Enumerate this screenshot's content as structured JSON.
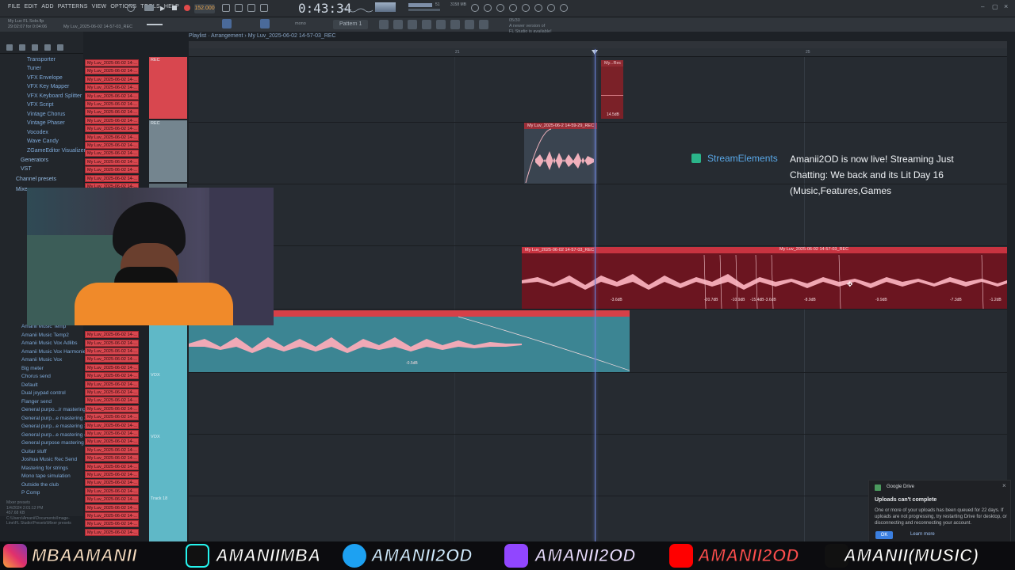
{
  "menu": [
    "FILE",
    "EDIT",
    "ADD",
    "PATTERNS",
    "VIEW",
    "OPTIONS",
    "TOOLS",
    "HELP"
  ],
  "transport": {
    "tempo": "152.000",
    "time": "0:43:34",
    "memory": "3158 MB",
    "cpu": "51"
  },
  "status": {
    "line1": "My Luv FL Solo.flp",
    "line2": "29:02:07 for 0:04:06",
    "line3": "My Luv_2025-06-02 14-57-03_REC"
  },
  "news": {
    "date": "05/30",
    "text1": "A newer version of",
    "text2": "FL Studio is available!"
  },
  "pattern_selector": "Pattern 1",
  "mono_label": "mono",
  "breadcrumb": "Playlist · Arrangement › My Luv_2025-06-02 14-57-03_REC",
  "browser": {
    "plugins": [
      "Transporter",
      "Tuner",
      "VFX Envelope",
      "VFX Key Mapper",
      "VFX Keyboard Splitter",
      "VFX Script",
      "Vintage Chorus",
      "Vintage Phaser",
      "Vocodex",
      "Wave Candy",
      "ZGameEditor Visualizer"
    ],
    "folders": [
      "Generators",
      "VST",
      "Channel presets",
      "Mixer"
    ],
    "presets": [
      "Amanii Music Temp",
      "Amanii Music Temp2",
      "Amanii Music Vox Adlibs",
      "Amanii Music Vox Harmonies",
      "Amanii Music Vox",
      "Big meter",
      "Chorus send",
      "Default",
      "Dual joypad control",
      "Flanger send",
      "General purpo...ir mastering",
      "General purp...e mastering 2",
      "General purp...e mastering 3",
      "General purp...e mastering 4",
      "General purpose mastering",
      "Guitar stuff",
      "Joshua Music Rec Send",
      "Mastering for strings",
      "Mono tape simulation",
      "Outside the club",
      "P Comp"
    ],
    "file_info": {
      "title": "Mixer presets",
      "date": "1/4/2024 2:01:12 PM",
      "size": "457.68 KB",
      "path": "C:\\Users\\Amanii\\Documents\\Image-Line\\FL Studio\\Presets\\Mixer presets"
    }
  },
  "clip_names": "My Luv_2025-06-02 14-...",
  "track_labels": {
    "rec1": "REC",
    "rec2": "REC",
    "vox1": "VOX",
    "vox2": "VOX",
    "track18": "Track 18"
  },
  "playlist_clips": {
    "clip_a_name": "My Luv_2025-06-2 14-59-29_REC",
    "clip_b_name": "My Luv_2025-06-02 14-57-03_REC",
    "clip_b_name2": "My Luv_2025-06-02 14-57-03_REC",
    "clip_c_name": "#3",
    "clip_d_name": "My...Rec",
    "clip_d_db": "14.5dB",
    "clip_c_db": "-0.5dB",
    "db_labels": [
      "-3.6dB",
      "-20.7dB",
      "-10.9dB",
      "-15.4dB",
      "-3.6dB",
      "-8.9dB",
      "-9.9dB",
      "-7.3dB",
      "-1.2dB"
    ]
  },
  "ruler_numbers": [
    "21",
    "25"
  ],
  "stream_alert": {
    "brand": "StreamElements",
    "message": "Amanii2OD is now live! Streaming Just Chatting: We back and its Lit Day 16 (Music,Features,Games"
  },
  "gdrive": {
    "title": "Google Drive",
    "heading": "Uploads can't complete",
    "body": "One or more of your uploads has been queued for 22 days. If uploads are not progressing, try restarting Drive for desktop, or disconnecting and reconnecting your account.",
    "ok": "OK",
    "learn": "Learn more"
  },
  "social": {
    "instagram": "MBAAMANII",
    "tiktok": "AMANIIMBA",
    "twitter": "AMANII2OD",
    "twitch": "AMANII2OD",
    "youtube": "AMANII2OD",
    "music": "AMANII(MUSIC)"
  },
  "colors": {
    "clip_red": "#d8474f",
    "clip_teal": "#5fb8c7",
    "playhead": "#6b82d8",
    "stream_blue": "#59a8e8"
  }
}
